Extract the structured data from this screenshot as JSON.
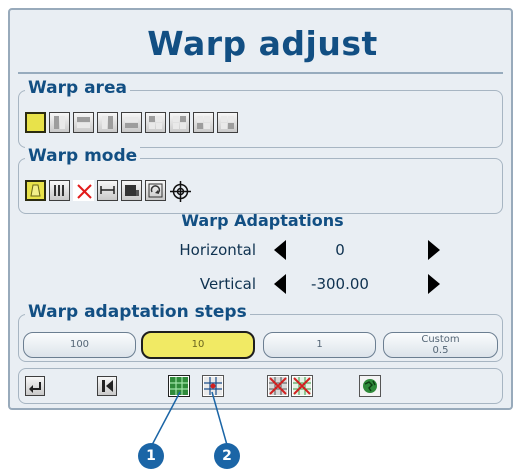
{
  "title": "Warp adjust",
  "warp_area": {
    "legend": "Warp area",
    "selected_index": 0
  },
  "warp_mode": {
    "legend": "Warp mode",
    "icons": [
      "keystone-icon",
      "bars-icon",
      "cross-icon",
      "stretch-icon",
      "corner-icon",
      "rotate-icon",
      "target-icon"
    ],
    "selected_index": 0
  },
  "adaptations": {
    "heading": "Warp Adaptations",
    "horizontal": {
      "label": "Horizontal",
      "value": "0"
    },
    "vertical": {
      "label": "Vertical",
      "value": "-300.00"
    }
  },
  "steps": {
    "legend": "Warp adaptation steps",
    "items": [
      {
        "label": "100"
      },
      {
        "label": "10"
      },
      {
        "label": "1"
      },
      {
        "label": "Custom",
        "sub": "0.5"
      }
    ],
    "selected_index": 1
  },
  "toolbar": {
    "icons": [
      "return-icon",
      "skip-back-icon",
      "grid-green-icon",
      "grid-red-icon",
      "clear-grid-icon",
      "reset-grid-icon",
      "globe-icon"
    ]
  },
  "callouts": [
    "1",
    "2"
  ],
  "colors": {
    "title": "#124f83",
    "selected": "#e8e24a",
    "panel": "#e9eef3",
    "callout": "#1b65a6"
  }
}
